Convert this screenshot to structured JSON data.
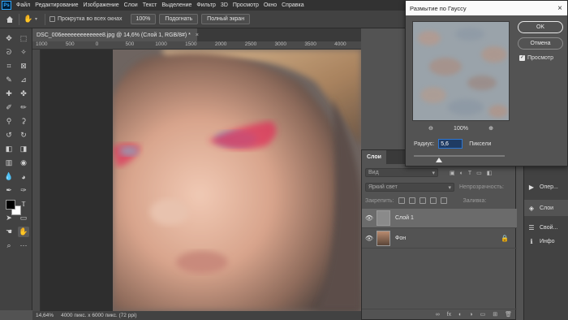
{
  "app": {
    "logo": "Ps"
  },
  "menu": [
    "Файл",
    "Редактирование",
    "Изображение",
    "Слои",
    "Текст",
    "Выделение",
    "Фильтр",
    "3D",
    "Просмотр",
    "Окно",
    "Справка"
  ],
  "options_bar": {
    "scroll_all_label": "Прокрутка во всех окнах",
    "zoom_value": "100%",
    "fit_label": "Подогнать",
    "fullscreen_label": "Полный экран"
  },
  "document": {
    "tab_title": "DSC_006eeeeeeeeeeeee8.jpg @ 14,6% (Слой 1, RGB/8#) *",
    "close_glyph": "×",
    "ruler_labels": [
      "1000",
      "500",
      "0",
      "500",
      "1000",
      "1500",
      "2000",
      "2500",
      "3000",
      "3500",
      "4000"
    ],
    "status": "14,64%     4000 пикс. x 6000 пикс. (72 ppi)"
  },
  "gauss_dialog": {
    "title": "Размытие по Гауссу",
    "close_glyph": "×",
    "zoom_out_glyph": "⊖",
    "zoom_in_glyph": "⊕",
    "zoom_level": "100%",
    "radius_label": "Радиус:",
    "radius_value": "5,6",
    "units": "Пиксели",
    "radius_fraction": 0.28,
    "ok_label": "OK",
    "cancel_label": "Отмена",
    "preview_label": "Просмотр",
    "preview_checked": true
  },
  "layers_panel": {
    "tab": "Слои",
    "kind_filter": "Вид",
    "blend_mode": "Яркий свет",
    "opacity_label": "Непрозрачность:",
    "lock_label": "Закрепить:",
    "fill_label": "Заливка:",
    "layers": [
      {
        "name": "Слой 1",
        "selected": true,
        "locked": false
      },
      {
        "name": "Фон",
        "selected": false,
        "locked": true
      }
    ],
    "footer_icons": [
      "link-icon",
      "fx-icon",
      "mask-icon",
      "adjustment-icon",
      "group-icon",
      "new-layer-icon",
      "trash-icon"
    ],
    "footer_glyphs": [
      "∞",
      "fx",
      "◐",
      "◑",
      "▭",
      "⊞",
      "🗑"
    ]
  },
  "right_dock": [
    {
      "label": "Опер...",
      "icon": "play-icon",
      "glyph": "▶"
    },
    {
      "label": "Слои",
      "icon": "layers-icon",
      "glyph": "◈"
    },
    {
      "label": "Свой...",
      "icon": "properties-icon",
      "glyph": "☰"
    },
    {
      "label": "Инфо",
      "icon": "info-icon",
      "glyph": "ℹ"
    }
  ],
  "colors": {
    "accent": "#2f77d2",
    "foreground_swatch": "#000000",
    "background_swatch": "#ffffff",
    "makeup_pink": "#e0305a"
  }
}
